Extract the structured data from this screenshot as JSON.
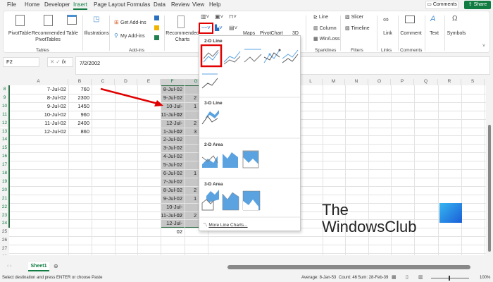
{
  "menu_tabs": [
    "File",
    "Home",
    "Developer",
    "Insert",
    "Page Layout",
    "Formulas",
    "Data",
    "Review",
    "View",
    "Help"
  ],
  "top_buttons": {
    "comments": "Comments",
    "share": "Share"
  },
  "ribbon": {
    "pivottable": "PivotTable",
    "recommended_pivottables": "Recommended PivotTables",
    "table": "Table",
    "tables_group": "Tables",
    "illustrations": "Illustrations",
    "get_addins": "Get Add-ins",
    "my_addins": "My Add-ins",
    "addins_group": "Add-ins",
    "recommended_charts": "Recommended Charts",
    "maps": "Maps",
    "pivotchart": "PivotChart",
    "threed": "3D",
    "line": "Line",
    "column": "Column",
    "winloss": "Win/Loss",
    "sparklines_group": "Sparklines",
    "slicer": "Slicer",
    "timeline": "Timeline",
    "filters_group": "Filters",
    "link": "Link",
    "links_group": "Links",
    "comment": "Comment",
    "comments_group": "Comments",
    "text": "Text",
    "symbols": "Symbols"
  },
  "formula_bar": {
    "name_box": "F2",
    "fx": "fx",
    "value": "7/2/2002"
  },
  "columns": [
    "A",
    "B",
    "C",
    "D",
    "E",
    "F",
    "G",
    "L",
    "M",
    "N",
    "O",
    "P",
    "Q",
    "R",
    "S"
  ],
  "rows": [
    {
      "n": "8",
      "a": "7-Jul-02",
      "b": "760",
      "f": "8-Jul-02",
      "g": ""
    },
    {
      "n": "9",
      "a": "8-Jul-02",
      "b": "2300",
      "f": "9-Jul-02",
      "g": "2"
    },
    {
      "n": "10",
      "a": "9-Jul-02",
      "b": "1450",
      "f": "10-Jul-02",
      "g": "1"
    },
    {
      "n": "11",
      "a": "10-Jul-02",
      "b": "960",
      "f": "11-Jul-02",
      "g": ""
    },
    {
      "n": "12",
      "a": "11-Jul-02",
      "b": "2400",
      "f": "12-Jul-02",
      "g": "2"
    },
    {
      "n": "13",
      "a": "12-Jul-02",
      "b": "860",
      "f": "1-Jul-02",
      "g": "3"
    },
    {
      "n": "14",
      "a": "",
      "b": "",
      "f": "2-Jul-02",
      "g": ""
    },
    {
      "n": "15",
      "a": "",
      "b": "",
      "f": "3-Jul-02",
      "g": ""
    },
    {
      "n": "16",
      "a": "",
      "b": "",
      "f": "4-Jul-02",
      "g": ""
    },
    {
      "n": "17",
      "a": "",
      "b": "",
      "f": "5-Jul-02",
      "g": ""
    },
    {
      "n": "18",
      "a": "",
      "b": "",
      "f": "6-Jul-02",
      "g": "1"
    },
    {
      "n": "19",
      "a": "",
      "b": "",
      "f": "7-Jul-02",
      "g": ""
    },
    {
      "n": "20",
      "a": "",
      "b": "",
      "f": "8-Jul-02",
      "g": "2"
    },
    {
      "n": "21",
      "a": "",
      "b": "",
      "f": "9-Jul-02",
      "g": "1"
    },
    {
      "n": "22",
      "a": "",
      "b": "",
      "f": "10-Jul-02",
      "g": ""
    },
    {
      "n": "23",
      "a": "",
      "b": "",
      "f": "11-Jul-02",
      "g": "2"
    },
    {
      "n": "24",
      "a": "",
      "b": "",
      "f": "12-Jul-02",
      "g": ""
    },
    {
      "n": "25",
      "a": "",
      "b": "",
      "f": "",
      "g": ""
    },
    {
      "n": "26",
      "a": "",
      "b": "",
      "f": "",
      "g": ""
    },
    {
      "n": "27",
      "a": "",
      "b": "",
      "f": "",
      "g": ""
    },
    {
      "n": "28",
      "a": "",
      "b": "",
      "f": "",
      "g": ""
    }
  ],
  "dropdown": {
    "line2d": "2-D Line",
    "line3d": "3-D Line",
    "area2d": "2-D Area",
    "area3d": "3-D Area",
    "more": "More Line Charts..."
  },
  "sheet_tab": "Sheet1",
  "status": {
    "message": "Select destination and press ENTER or choose Paste",
    "average": "Average: 8-Jan-53",
    "count": "Count: 46",
    "sum": "Sum: 28-Feb-39",
    "zoom": "100%",
    "zoom_level": 100
  },
  "watermark": {
    "line1": "The",
    "line2": "WindowsClub"
  },
  "colors": {
    "accent": "#107c41",
    "highlight": "#e00000",
    "chart_blue": "#5ba3e0"
  }
}
